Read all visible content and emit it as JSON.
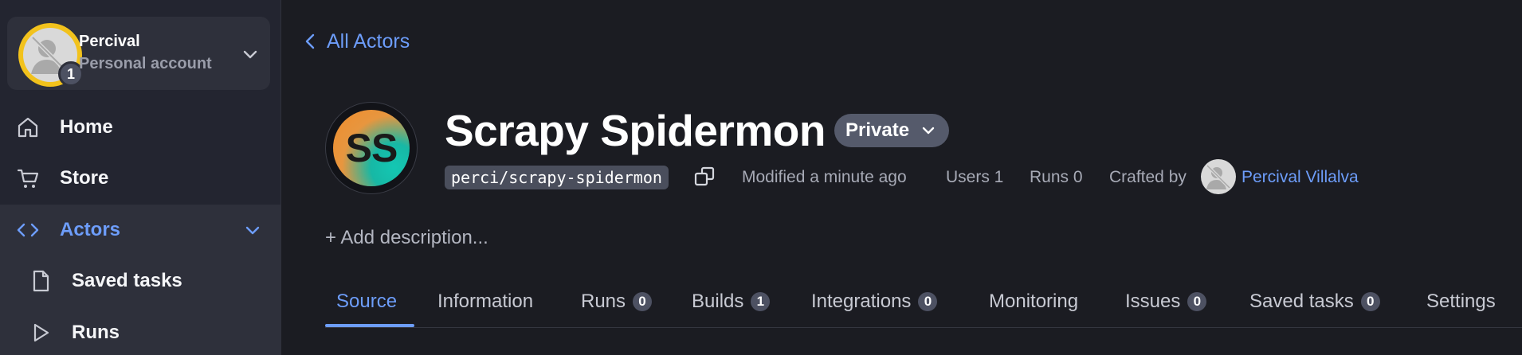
{
  "account": {
    "name": "Percival",
    "type": "Personal account",
    "notification_count": "1"
  },
  "nav": {
    "home": "Home",
    "store": "Store",
    "actors": "Actors",
    "saved_tasks": "Saved tasks",
    "runs": "Runs"
  },
  "breadcrumb": {
    "back_label": "All Actors"
  },
  "actor": {
    "logo_initials": "SS",
    "title": "Scrapy Spidermon",
    "visibility": "Private",
    "slug": "perci/scrapy-spidermon",
    "modified": "Modified a minute ago",
    "users": "Users 1",
    "runs": "Runs 0",
    "crafted_by_label": "Crafted by",
    "author": "Percival Villalva",
    "add_description": "+ Add description..."
  },
  "tabs": [
    {
      "label": "Source",
      "count": null
    },
    {
      "label": "Information",
      "count": null
    },
    {
      "label": "Runs",
      "count": "0"
    },
    {
      "label": "Builds",
      "count": "1"
    },
    {
      "label": "Integrations",
      "count": "0"
    },
    {
      "label": "Monitoring",
      "count": null
    },
    {
      "label": "Issues",
      "count": "0"
    },
    {
      "label": "Saved tasks",
      "count": "0"
    },
    {
      "label": "Settings",
      "count": null
    }
  ],
  "colors": {
    "accent": "#6d9dfa",
    "background": "#1b1c22",
    "sidebar": "#232530",
    "avatar_ring": "#f2c21c"
  }
}
